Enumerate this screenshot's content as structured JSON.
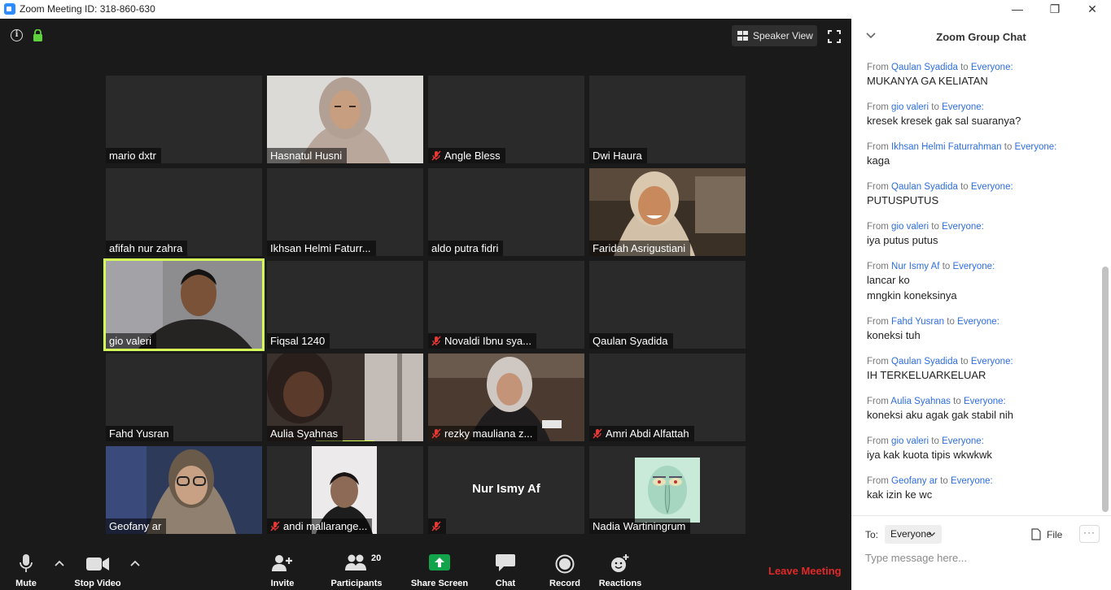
{
  "window": {
    "title": "Zoom Meeting ID: 318-860-630",
    "minimize": "—",
    "restore": "❐",
    "close": "✕"
  },
  "top_bar": {
    "info": "i",
    "speaker_view_label": "Speaker View"
  },
  "colors": {
    "accent_blue": "#2d8cff",
    "active_speaker": "#d6ff5a",
    "leave_red": "#e22828",
    "lock_green": "#5fd13a",
    "share_green": "#12a44a",
    "mute_red": "#e53935"
  },
  "participants": [
    {
      "name": "mario dxtr",
      "muted": false
    },
    {
      "name": "Hasnatul Husni",
      "muted": false,
      "video": "headscarf-light"
    },
    {
      "name": "Angle Bless",
      "muted": true
    },
    {
      "name": "Dwi Haura",
      "muted": false
    },
    {
      "name": "afifah nur zahra",
      "muted": false
    },
    {
      "name": "Ikhsan Helmi Faturr...",
      "muted": false
    },
    {
      "name": "aldo putra fidri",
      "muted": false
    },
    {
      "name": "Faridah Asrigustiani",
      "muted": false,
      "video": "headscarf-smile"
    },
    {
      "name": "gio valeri",
      "muted": false,
      "active_speaker": true,
      "video": "man-dark"
    },
    {
      "name": "Fiqsal 1240",
      "muted": false
    },
    {
      "name": "Novaldi Ibnu sya...",
      "muted": true
    },
    {
      "name": "Qaulan Syadida",
      "muted": false
    },
    {
      "name": "Fahd Yusran",
      "muted": false
    },
    {
      "name": "Aulia Syahnas",
      "muted": false,
      "video": "man-dim"
    },
    {
      "name": "rezky mauliana z...",
      "muted": true,
      "video": "headscarf-reading"
    },
    {
      "name": "Amri Abdi Alfattah",
      "muted": true
    },
    {
      "name": "Geofany ar",
      "muted": false,
      "video": "woman-glasses"
    },
    {
      "name": "andi mallarange...",
      "muted": true,
      "video": "man-portrait"
    },
    {
      "name": "",
      "center_name": "Nur Ismy Af",
      "muted": true
    },
    {
      "name": "Nadia Wartiningrum",
      "muted": false,
      "video": "squidward-avatar"
    }
  ],
  "toolbar": {
    "mute": "Mute",
    "stop_video": "Stop Video",
    "invite": "Invite",
    "participants": "Participants",
    "participant_count": "20",
    "share_screen": "Share Screen",
    "chat": "Chat",
    "record": "Record",
    "reactions": "Reactions",
    "leave": "Leave Meeting"
  },
  "chat": {
    "title": "Zoom Group Chat",
    "messages": [
      {
        "from_word": "From",
        "sender": "Qaulan Syadida",
        "to_word": "to",
        "target": "Everyone:",
        "text": "MUKANYA GA KELIATAN"
      },
      {
        "from_word": "From",
        "sender": "gio valeri",
        "to_word": "to",
        "target": "Everyone:",
        "text": "kresek kresek gak sal suaranya?"
      },
      {
        "from_word": "From",
        "sender": "Ikhsan Helmi Faturrahman",
        "to_word": "to",
        "target": "Everyone:",
        "text": "kaga"
      },
      {
        "from_word": "From",
        "sender": "Qaulan Syadida",
        "to_word": "to",
        "target": "Everyone:",
        "text": "PUTUSPUTUS"
      },
      {
        "from_word": "From",
        "sender": "gio valeri",
        "to_word": "to",
        "target": "Everyone:",
        "text": "iya putus putus"
      },
      {
        "from_word": "From",
        "sender": "Nur Ismy Af",
        "to_word": "to",
        "target": "Everyone:",
        "text": "lancar ko",
        "text2": "mngkin koneksinya"
      },
      {
        "from_word": "From",
        "sender": "Fahd Yusran",
        "to_word": "to",
        "target": "Everyone:",
        "text": "koneksi tuh"
      },
      {
        "from_word": "From",
        "sender": "Qaulan Syadida",
        "to_word": "to",
        "target": "Everyone:",
        "text": "IH TERKELUARKELUAR"
      },
      {
        "from_word": "From",
        "sender": "Aulia Syahnas",
        "to_word": "to",
        "target": "Everyone:",
        "text": "koneksi aku agak gak stabil nih"
      },
      {
        "from_word": "From",
        "sender": "gio valeri",
        "to_word": "to",
        "target": "Everyone:",
        "text": "iya kak kuota tipis wkwkwk"
      },
      {
        "from_word": "From",
        "sender": "Geofany ar",
        "to_word": "to",
        "target": "Everyone:",
        "text": "kak izin ke wc"
      }
    ],
    "to_label": "To:",
    "to_value": "Everyone",
    "file_label": "File",
    "more_label": "···",
    "input_placeholder": "Type message here..."
  }
}
